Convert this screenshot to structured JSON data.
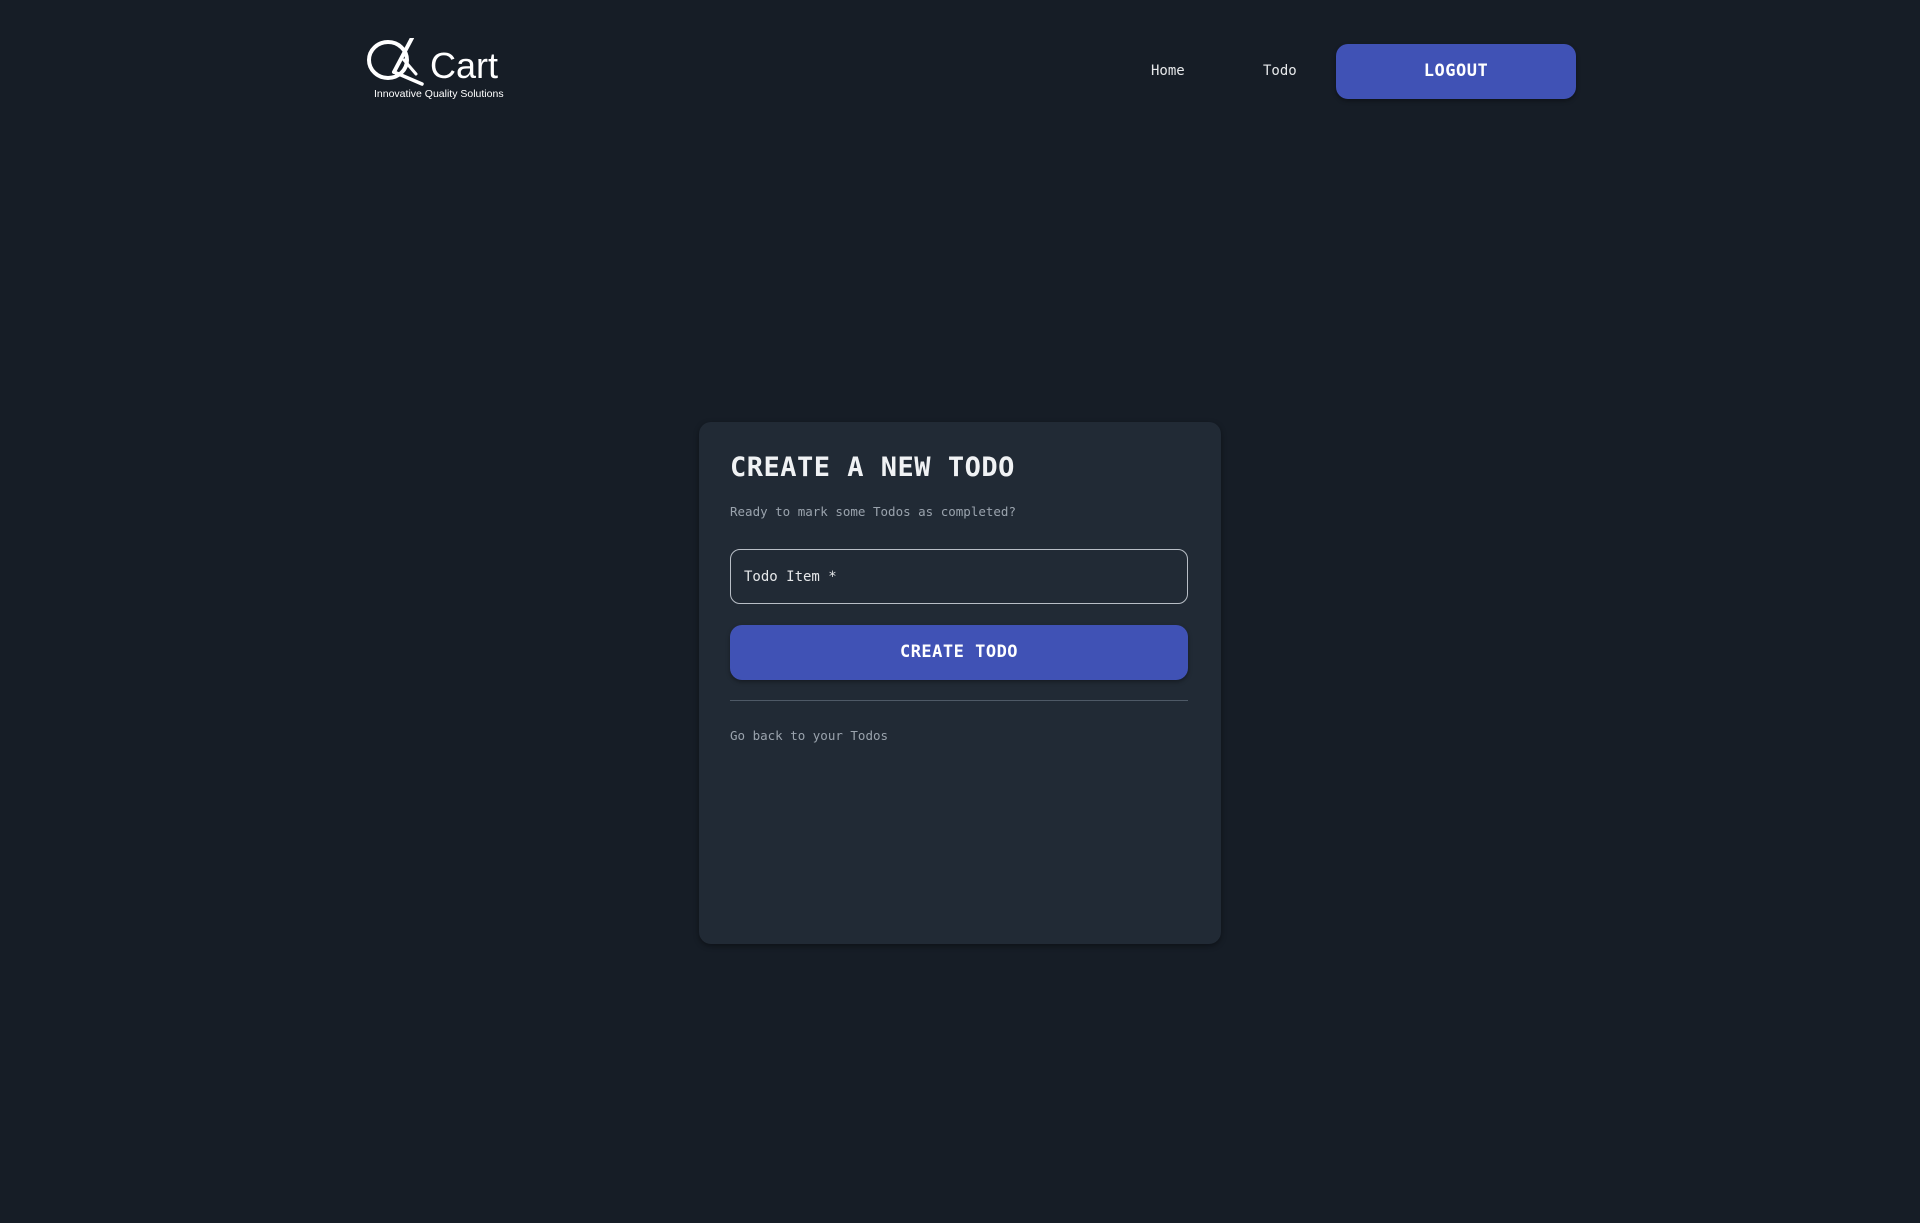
{
  "header": {
    "logo": {
      "text": "QkCart",
      "tagline": "Innovative Quality Solutions"
    },
    "nav": {
      "home": "Home",
      "todo": "Todo",
      "logout": "LOGOUT"
    }
  },
  "card": {
    "title": "CREATE A NEW TODO",
    "subtitle": "Ready to mark some Todos as completed?",
    "input_placeholder": "Todo Item *",
    "input_value": "",
    "create_button": "CREATE TODO",
    "back_link": "Go back to your Todos"
  },
  "colors": {
    "background": "#161d26",
    "card": "#212a35",
    "primary": "#4052b5"
  }
}
